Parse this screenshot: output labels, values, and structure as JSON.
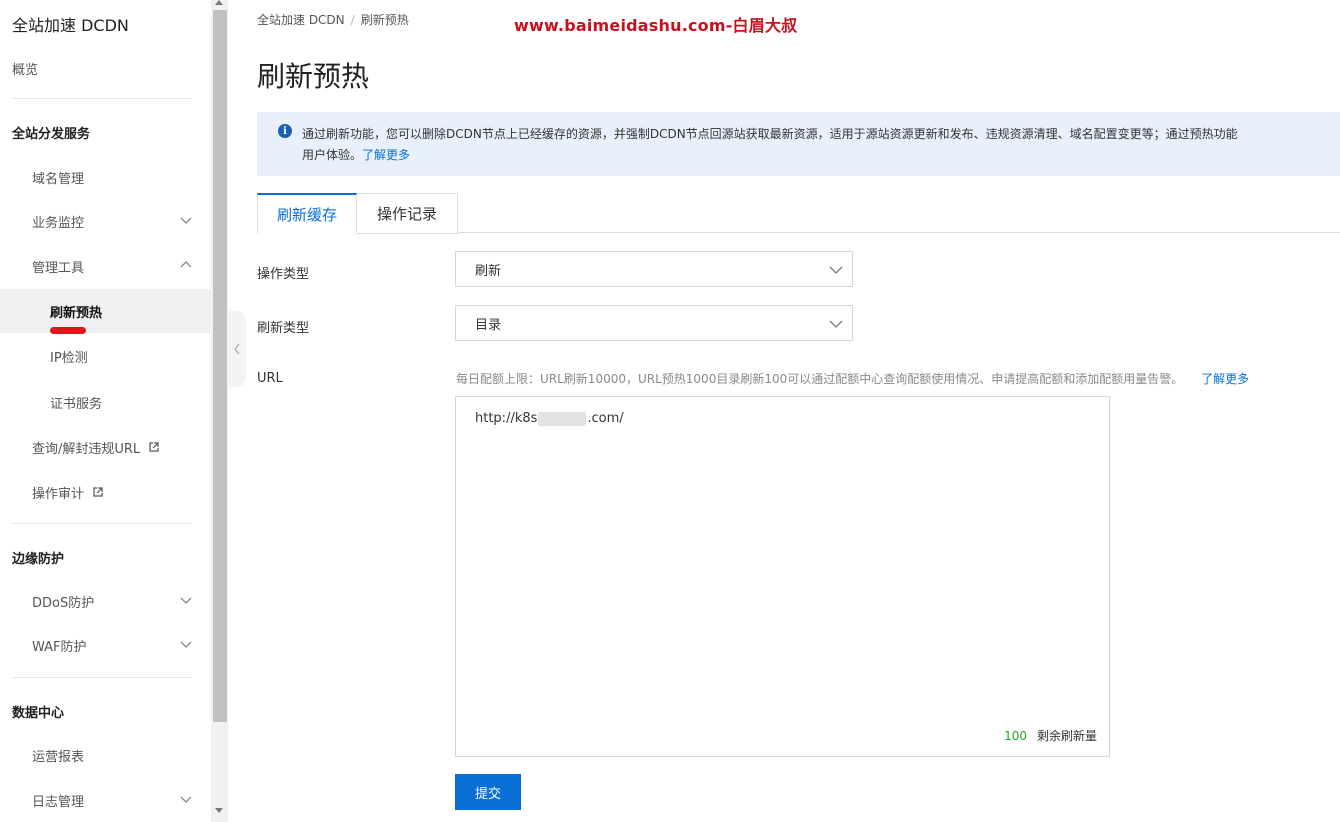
{
  "sidebar": {
    "title": "全站加速 DCDN",
    "overview": "概览",
    "groups": {
      "distribution": "全站分发服务",
      "edge": "边缘防护",
      "data": "数据中心"
    },
    "items": {
      "domain": "域名管理",
      "monitor": "业务监控",
      "tools": "管理工具",
      "refresh": "刷新预热",
      "ip": "IP检测",
      "cert": "证书服务",
      "query_url": "查询/解封违规URL",
      "audit": "操作审计",
      "ddos": "DDoS防护",
      "waf": "WAF防护",
      "report": "运营报表",
      "logs": "日志管理"
    }
  },
  "breadcrumb": {
    "root": "全站加速 DCDN",
    "sep": "/",
    "current": "刷新预热"
  },
  "watermark": "www.baimeidashu.com-白眉大叔",
  "page": {
    "title": "刷新预热"
  },
  "notice": {
    "line1": "通过刷新功能，您可以删除DCDN节点上已经缓存的资源，并强制DCDN节点回源站获取最新资源，适用于源站资源更新和发布、违规资源清理、域名配置变更等；通过预热功能",
    "line2": "用户体验。",
    "link": "了解更多"
  },
  "tabs": {
    "active": "刷新缓存",
    "other": "操作记录"
  },
  "form": {
    "op_type_label": "操作类型",
    "op_type_value": "刷新",
    "refresh_type_label": "刷新类型",
    "refresh_type_value": "目录",
    "url_label": "URL",
    "quota_hint": "每日配额上限：URL刷新10000，URL预热1000目录刷新100可以通过配额中心查询配额使用情况、申请提高配额和添加配额用量告警。",
    "quota_link": "了解更多",
    "url_prefix": "http://k8s",
    "url_suffix": ".com/",
    "remaining_count": "100",
    "remaining_label": "剩余刷新量",
    "submit_label": "提交"
  },
  "colors": {
    "accent": "#0a6fd6",
    "marker": "#e0161b",
    "notice_bg": "#e8f1fb"
  }
}
